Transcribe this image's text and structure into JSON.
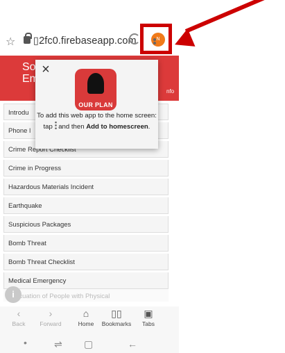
{
  "browser": {
    "url": "▯2fc0.firebaseapp.com",
    "badge_text": "N"
  },
  "header": {
    "left_fragment": "So\nEm",
    "right_fragment": "it",
    "info_fragment": "nfo"
  },
  "list_items": [
    "Introdu",
    "Phone l",
    "Crime Report Checklist",
    "Crime in Progress",
    "Hazardous Materials Incident",
    "Earthquake",
    "Suspicious Packages",
    "Bomb Threat",
    "Bomb Threat Checklist",
    "Medical Emergency"
  ],
  "faded_item": "Evacuation of People with Physical",
  "fab_label": "i",
  "popup": {
    "close": "×",
    "icon_caption": "OUR PLAN",
    "text_pre": "To add this web app to the home screen: tap",
    "text_mid": "and then",
    "text_bold": "Add to homescreen",
    "text_end": "."
  },
  "toolbar": {
    "back": "Back",
    "forward": "Forward",
    "home": "Home",
    "bookmarks": "Bookmarks",
    "tabs": "Tabs"
  },
  "colors": {
    "header_red": "#dc3a3a",
    "annotation_red": "#cc0000",
    "badge_orange": "#f07a1a"
  }
}
